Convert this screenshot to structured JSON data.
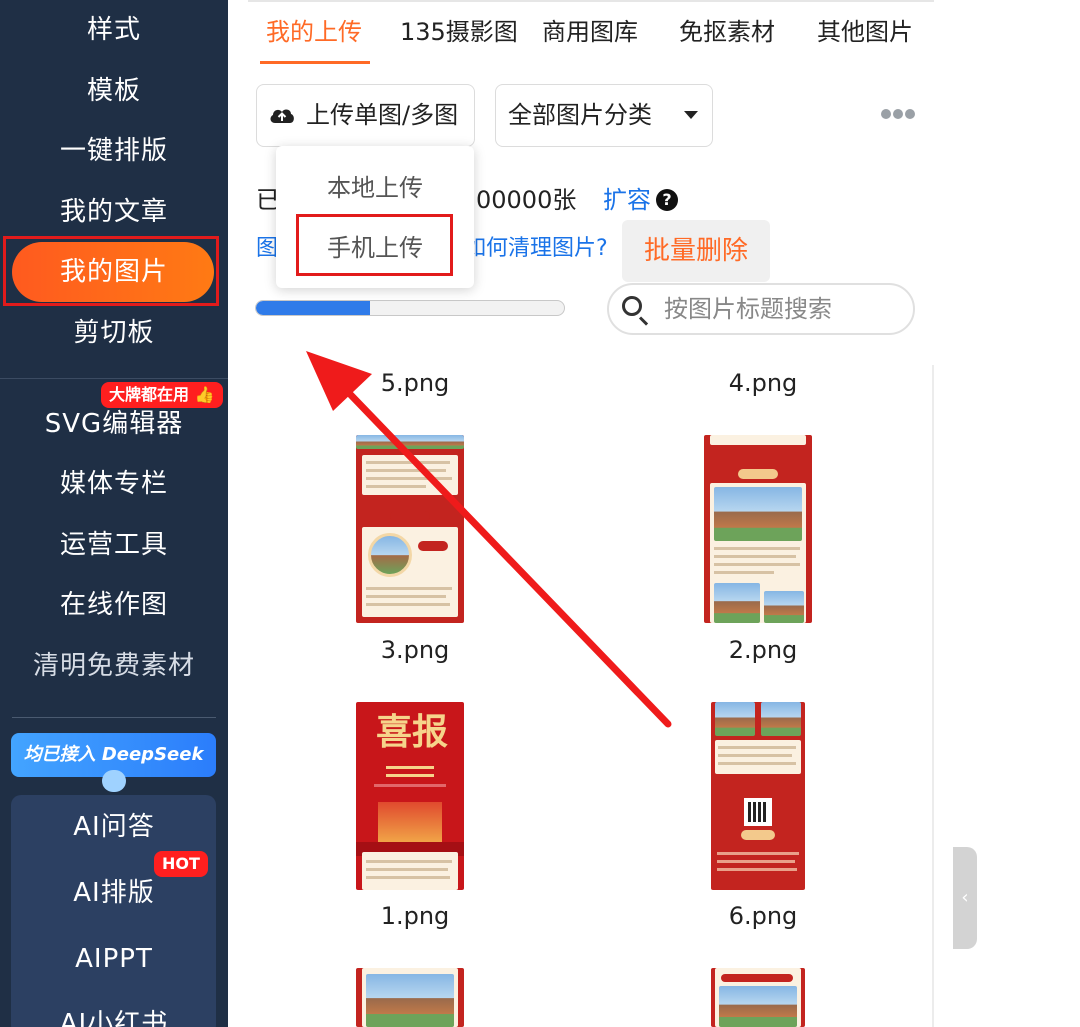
{
  "sidebar": {
    "items": [
      {
        "label": "样式"
      },
      {
        "label": "模板"
      },
      {
        "label": "一键排版"
      },
      {
        "label": "我的文章"
      },
      {
        "label": "我的图片"
      },
      {
        "label": "剪切板"
      },
      {
        "label": "SVG编辑器"
      },
      {
        "label": "媒体专栏"
      },
      {
        "label": "运营工具"
      },
      {
        "label": "在线作图"
      },
      {
        "label": "清明免费素材"
      }
    ],
    "active_index": 4,
    "svg_badge": "大牌都在用",
    "svg_badge_icon": "thumbs-up-icon",
    "deepseek_banner": "均已接入 DeepSeek",
    "ai_items": [
      {
        "label": "AI问答"
      },
      {
        "label": "AI排版"
      },
      {
        "label": "AIPPT"
      },
      {
        "label": "AI小红书"
      }
    ],
    "hot_badge": "HOT"
  },
  "tabs": [
    {
      "label": "我的上传"
    },
    {
      "label": "135摄影图"
    },
    {
      "label": "商用图库"
    },
    {
      "label": "免抠素材"
    },
    {
      "label": "其他图片"
    }
  ],
  "toolbar": {
    "upload_button": "上传单图/多图",
    "upload_icon": "cloud-upload-icon",
    "category_select": "全部图片分类",
    "more_icon": "more-dots-icon"
  },
  "upload_menu": {
    "items": [
      {
        "label": "本地上传"
      },
      {
        "label": "手机上传"
      }
    ],
    "highlighted_index": 1
  },
  "usage": {
    "prefix": "已",
    "quota_text": "00000张",
    "expand_link": "扩容",
    "help_icon": "?",
    "link_prefix": "图",
    "clean_link": "如何清理图片?",
    "progress_fraction": 0.37
  },
  "actions": {
    "bulk_delete": "批量删除"
  },
  "search": {
    "placeholder": "按图片标题搜索"
  },
  "gallery": {
    "items": [
      {
        "name": "5.png"
      },
      {
        "name": "4.png"
      },
      {
        "name": "3.png"
      },
      {
        "name": "2.png"
      },
      {
        "name": "1.png",
        "headline": "喜报"
      },
      {
        "name": "6.png"
      }
    ]
  },
  "colors": {
    "sidebar_bg": "#1f2f45",
    "accent_orange": "#ff6a26",
    "highlight_red": "#e21b1b",
    "link_blue": "#1a73e8",
    "progress_blue": "#2f7be9"
  }
}
